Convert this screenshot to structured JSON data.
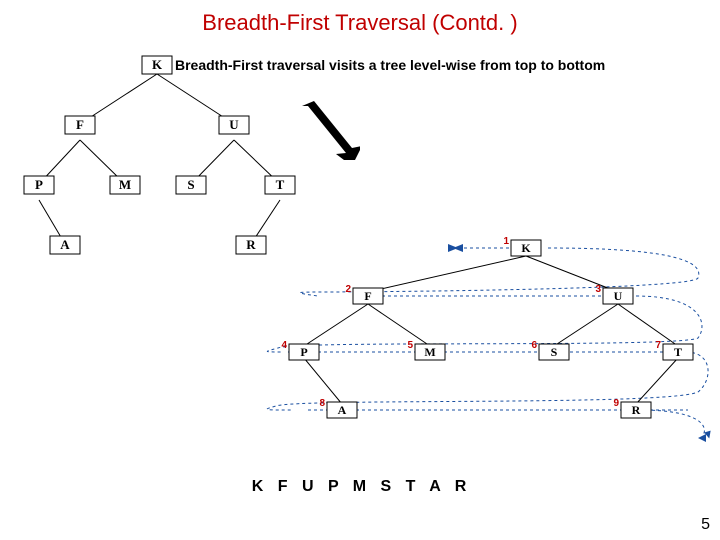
{
  "title": "Breadth-First Traversal (Contd. )",
  "subtitle": "Breadth-First traversal visits a tree level-wise from top to bottom",
  "sequence_text": "K  F  U  P  M  S  T  A  R",
  "page_number": "5",
  "tree": {
    "nodes": [
      "K",
      "F",
      "U",
      "P",
      "M",
      "S",
      "T",
      "A",
      "R"
    ],
    "edges": [
      [
        "K",
        "F"
      ],
      [
        "K",
        "U"
      ],
      [
        "F",
        "P"
      ],
      [
        "F",
        "M"
      ],
      [
        "U",
        "S"
      ],
      [
        "U",
        "T"
      ],
      [
        "P",
        "A"
      ],
      [
        "T",
        "R"
      ]
    ]
  },
  "traversal": {
    "order_labels": [
      "1",
      "2",
      "3",
      "4",
      "5",
      "6",
      "7",
      "8",
      "9"
    ],
    "nodes_in_order": [
      "K",
      "F",
      "U",
      "P",
      "M",
      "S",
      "T",
      "A",
      "R"
    ]
  }
}
